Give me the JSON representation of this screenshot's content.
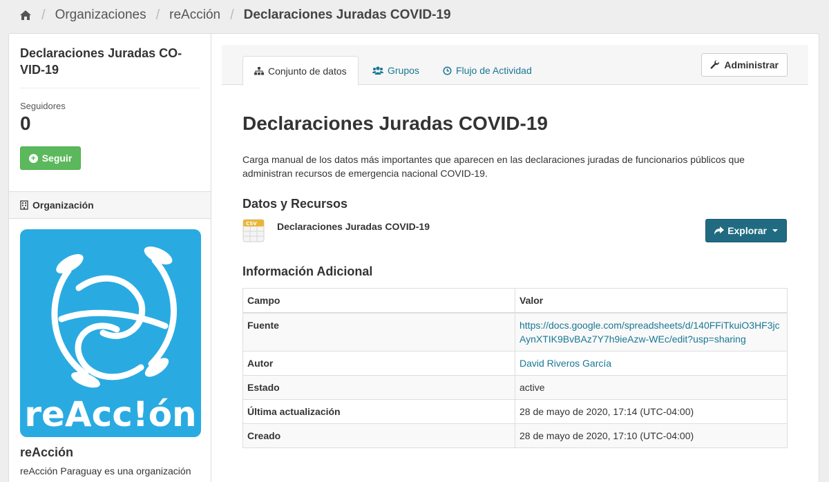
{
  "breadcrumb": {
    "items": [
      "Organizaciones",
      "reAcción"
    ],
    "current": "Declaraciones Juradas COVID-19"
  },
  "sidebar": {
    "title": "Declaraciones Juradas CO-VID-19",
    "followers_label": "Seguidores",
    "followers_count": "0",
    "follow_label": "Seguir",
    "org_section_label": "Organización",
    "org_logo_text": "reAcc!ón",
    "org_name": "reAcción",
    "org_description": "reAcción Paraguay es una organización"
  },
  "tabs": [
    {
      "label": "Conjunto de datos",
      "icon": "sitemap-icon",
      "active": true
    },
    {
      "label": "Grupos",
      "icon": "users-icon",
      "active": false
    },
    {
      "label": "Flujo de Actividad",
      "icon": "clock-icon",
      "active": false
    }
  ],
  "admin_label": "Administrar",
  "dataset": {
    "title": "Declaraciones Juradas COVID-19",
    "description": "Carga manual de los datos más importantes que aparecen en las declaraciones juradas de funcionarios públicos que administran recursos de emergencia nacional COVID-19."
  },
  "resources": {
    "heading": "Datos y Recursos",
    "items": [
      {
        "name": "Declaraciones Juradas COVID-19",
        "format": "CSV"
      }
    ],
    "explore_label": "Explorar"
  },
  "info": {
    "heading": "Información Adicional",
    "columns": [
      "Campo",
      "Valor"
    ],
    "rows": [
      {
        "key": "Fuente",
        "value": "https://docs.google.com/spreadsheets/d/140FFiTkuiO3HF3jcAynXTIK9BvBAz7Y7h9ieAzw-WEc/edit?usp=sharing"
      },
      {
        "key": "Autor",
        "value": "David Riveros García"
      },
      {
        "key": "Estado",
        "value": "active"
      },
      {
        "key": "Última actualización",
        "value": "28 de mayo de 2020, 17:14 (UTC-04:00)"
      },
      {
        "key": "Creado",
        "value": "28 de mayo de 2020, 17:10 (UTC-04:00)"
      }
    ]
  },
  "colors": {
    "accent": "#187794",
    "follow_green": "#5cb85c",
    "explore_blue": "#206b82",
    "logo_blue": "#29abe2"
  }
}
